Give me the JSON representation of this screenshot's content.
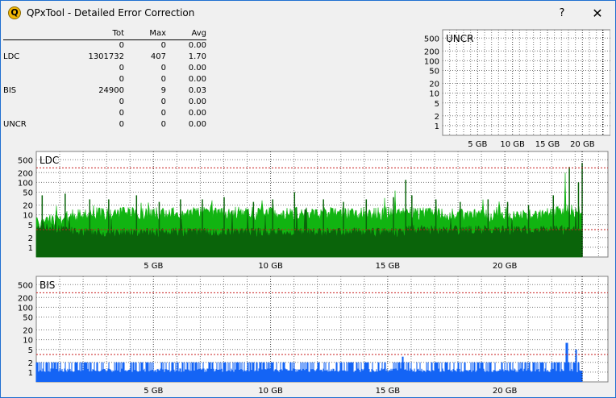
{
  "window": {
    "title": "QPxTool - Detailed Error Correction",
    "icon": "Q",
    "help_label": "?",
    "close_label": "✕"
  },
  "stats": {
    "headers": [
      "",
      "Tot",
      "Max",
      "Avg"
    ],
    "rows": [
      [
        "",
        "0",
        "0",
        "0.00"
      ],
      [
        "LDC",
        "1301732",
        "407",
        "1.70"
      ],
      [
        "",
        "0",
        "0",
        "0.00"
      ],
      [
        "",
        "0",
        "0",
        "0.00"
      ],
      [
        "BIS",
        "24900",
        "9",
        "0.03"
      ],
      [
        "",
        "0",
        "0",
        "0.00"
      ],
      [
        "",
        "0",
        "0",
        "0.00"
      ],
      [
        "UNCR",
        "0",
        "0",
        "0.00"
      ]
    ]
  },
  "colors": {
    "ldc_light": "#11b411",
    "ldc_dark": "#0a640a",
    "bis": "#1464f5",
    "ref_line": "#c81e1e",
    "grid": "#7a7a7a"
  },
  "chart_data": [
    {
      "type": "area",
      "title": "UNCR",
      "y_scale": "log",
      "y_ticks": [
        "500",
        "200",
        "100",
        "50",
        "20",
        "10",
        "5",
        "2",
        "1"
      ],
      "x_ticks": [
        "5 GB",
        "10 GB",
        "15 GB",
        "20 GB"
      ],
      "xlim": [
        0,
        24
      ],
      "data_end_gb": 22.9,
      "series": []
    },
    {
      "type": "area",
      "title": "LDC",
      "y_scale": "log",
      "y_ticks": [
        "500",
        "200",
        "100",
        "50",
        "20",
        "10",
        "5",
        "2",
        "1"
      ],
      "x_ticks": [
        "5 GB",
        "10 GB",
        "15 GB",
        "20 GB"
      ],
      "xlim": [
        0,
        24.4
      ],
      "data_end_gb": 23.3,
      "thresholds": [
        280,
        3.5
      ],
      "series": [
        {
          "x": [
            0,
            1,
            2,
            3,
            4,
            5,
            6,
            7,
            8,
            9,
            10,
            11,
            12,
            13,
            14,
            15,
            15.5,
            16,
            17,
            18,
            19,
            20,
            21,
            22,
            22.5,
            23,
            23.3
          ],
          "peak": [
            40,
            45,
            30,
            30,
            40,
            25,
            30,
            30,
            35,
            25,
            30,
            50,
            30,
            25,
            30,
            35,
            120,
            40,
            30,
            25,
            30,
            25,
            20,
            40,
            300,
            100,
            400
          ],
          "typical": [
            6,
            8,
            12,
            12,
            12,
            12,
            12,
            12,
            13,
            12,
            12,
            12,
            12,
            12,
            12,
            12,
            12,
            12,
            12,
            11,
            11,
            10,
            10,
            12,
            15,
            14,
            12
          ],
          "base": [
            4,
            3,
            2.5,
            2.5,
            2.5,
            2.5,
            2.5,
            2.5,
            2.5,
            2.5,
            2.5,
            2.5,
            2.5,
            2.5,
            2.5,
            2.5,
            2.5,
            3,
            3,
            3,
            3,
            3,
            3,
            3,
            3,
            3,
            3
          ]
        }
      ]
    },
    {
      "type": "bar",
      "title": "BIS",
      "y_scale": "log",
      "y_ticks": [
        "500",
        "200",
        "100",
        "50",
        "20",
        "10",
        "5",
        "2",
        "1"
      ],
      "x_ticks": [
        "5 GB",
        "10 GB",
        "15 GB",
        "20 GB"
      ],
      "xlim": [
        0,
        24.4
      ],
      "data_end_gb": 23.3,
      "thresholds": [
        280,
        3.5
      ],
      "series": [
        {
          "x": [
            0,
            2,
            4,
            6,
            8,
            10,
            12,
            14,
            15.6,
            17,
            19,
            21,
            22.2,
            22.6,
            23,
            23.3
          ],
          "values": [
            2,
            2,
            2,
            2,
            2,
            2,
            2,
            2,
            3,
            2,
            2,
            2,
            2,
            8,
            5,
            9
          ]
        }
      ]
    }
  ]
}
